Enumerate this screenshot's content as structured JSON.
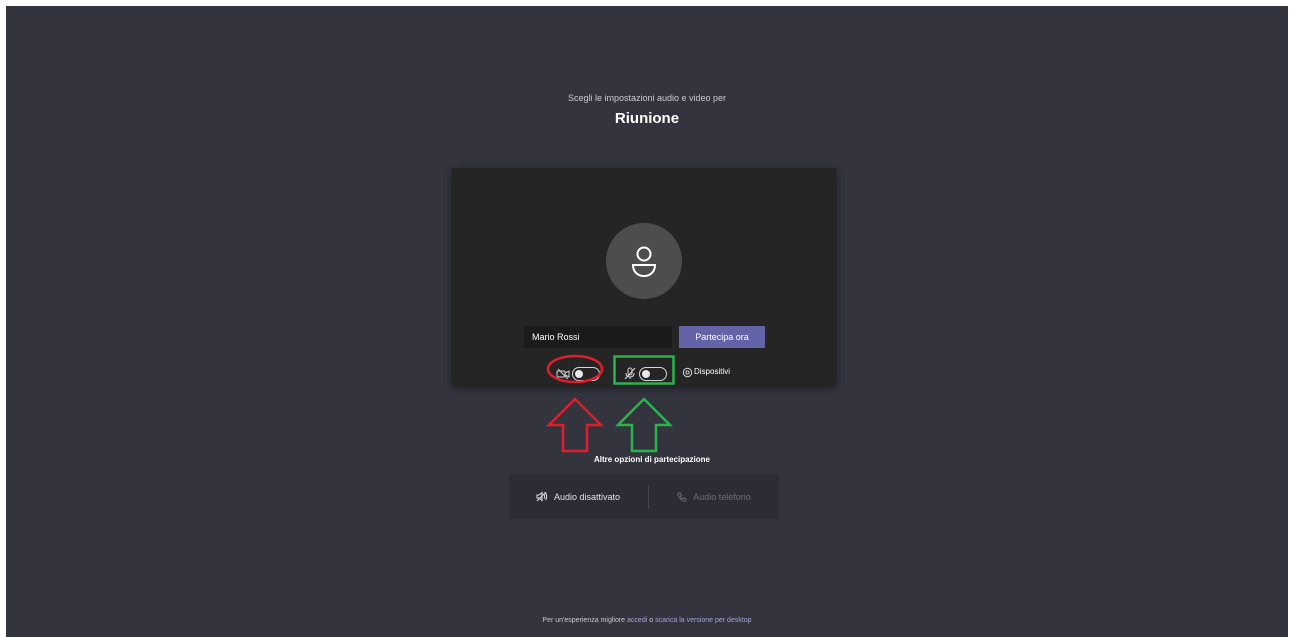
{
  "header": {
    "subtitle": "Scegli le impostazioni audio e video per",
    "title": "Riunione"
  },
  "preview": {
    "name_value": "Mario Rossi",
    "join_label": "Partecipa ora",
    "camera_toggle_on": false,
    "mic_toggle_on": false,
    "devices_label": "Dispositivi"
  },
  "more_options": {
    "heading": "Altre opzioni di partecipazione",
    "audio_off_label": "Audio disattivato",
    "phone_audio_label": "Audio telefono"
  },
  "footer": {
    "prefix": "Per un'esperienza migliore",
    "login_link": "accedi",
    "middle": "o",
    "download_link": "scarica la versione per desktop"
  },
  "colors": {
    "background": "#34343f",
    "primary": "#6264a7",
    "annotation_red": "#e01e2b",
    "annotation_green": "#2bb24c"
  }
}
